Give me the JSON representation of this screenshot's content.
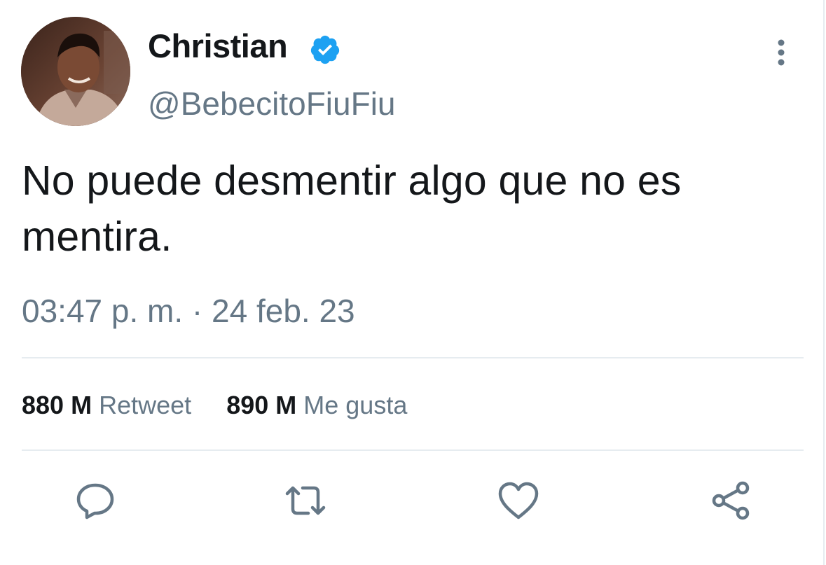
{
  "user": {
    "display_name": "Christian",
    "handle": "@BebecitoFiuFiu",
    "verified": true,
    "avatar": "profile-photo"
  },
  "tweet": {
    "text": "No puede desmentir algo que no es mentira.",
    "timestamp": "03:47 p. m. · 24 feb. 23"
  },
  "stats": {
    "retweets_count": "880 M",
    "retweets_label": "Retweet",
    "likes_count": "890 M",
    "likes_label": "Me gusta"
  },
  "actions": [
    {
      "icon": "reply-icon"
    },
    {
      "icon": "retweet-icon"
    },
    {
      "icon": "like-icon"
    },
    {
      "icon": "share-icon"
    }
  ],
  "colors": {
    "text": "#14171a",
    "secondary": "#657786",
    "verified": "#1da1f2",
    "divider": "#e6ecf0"
  }
}
